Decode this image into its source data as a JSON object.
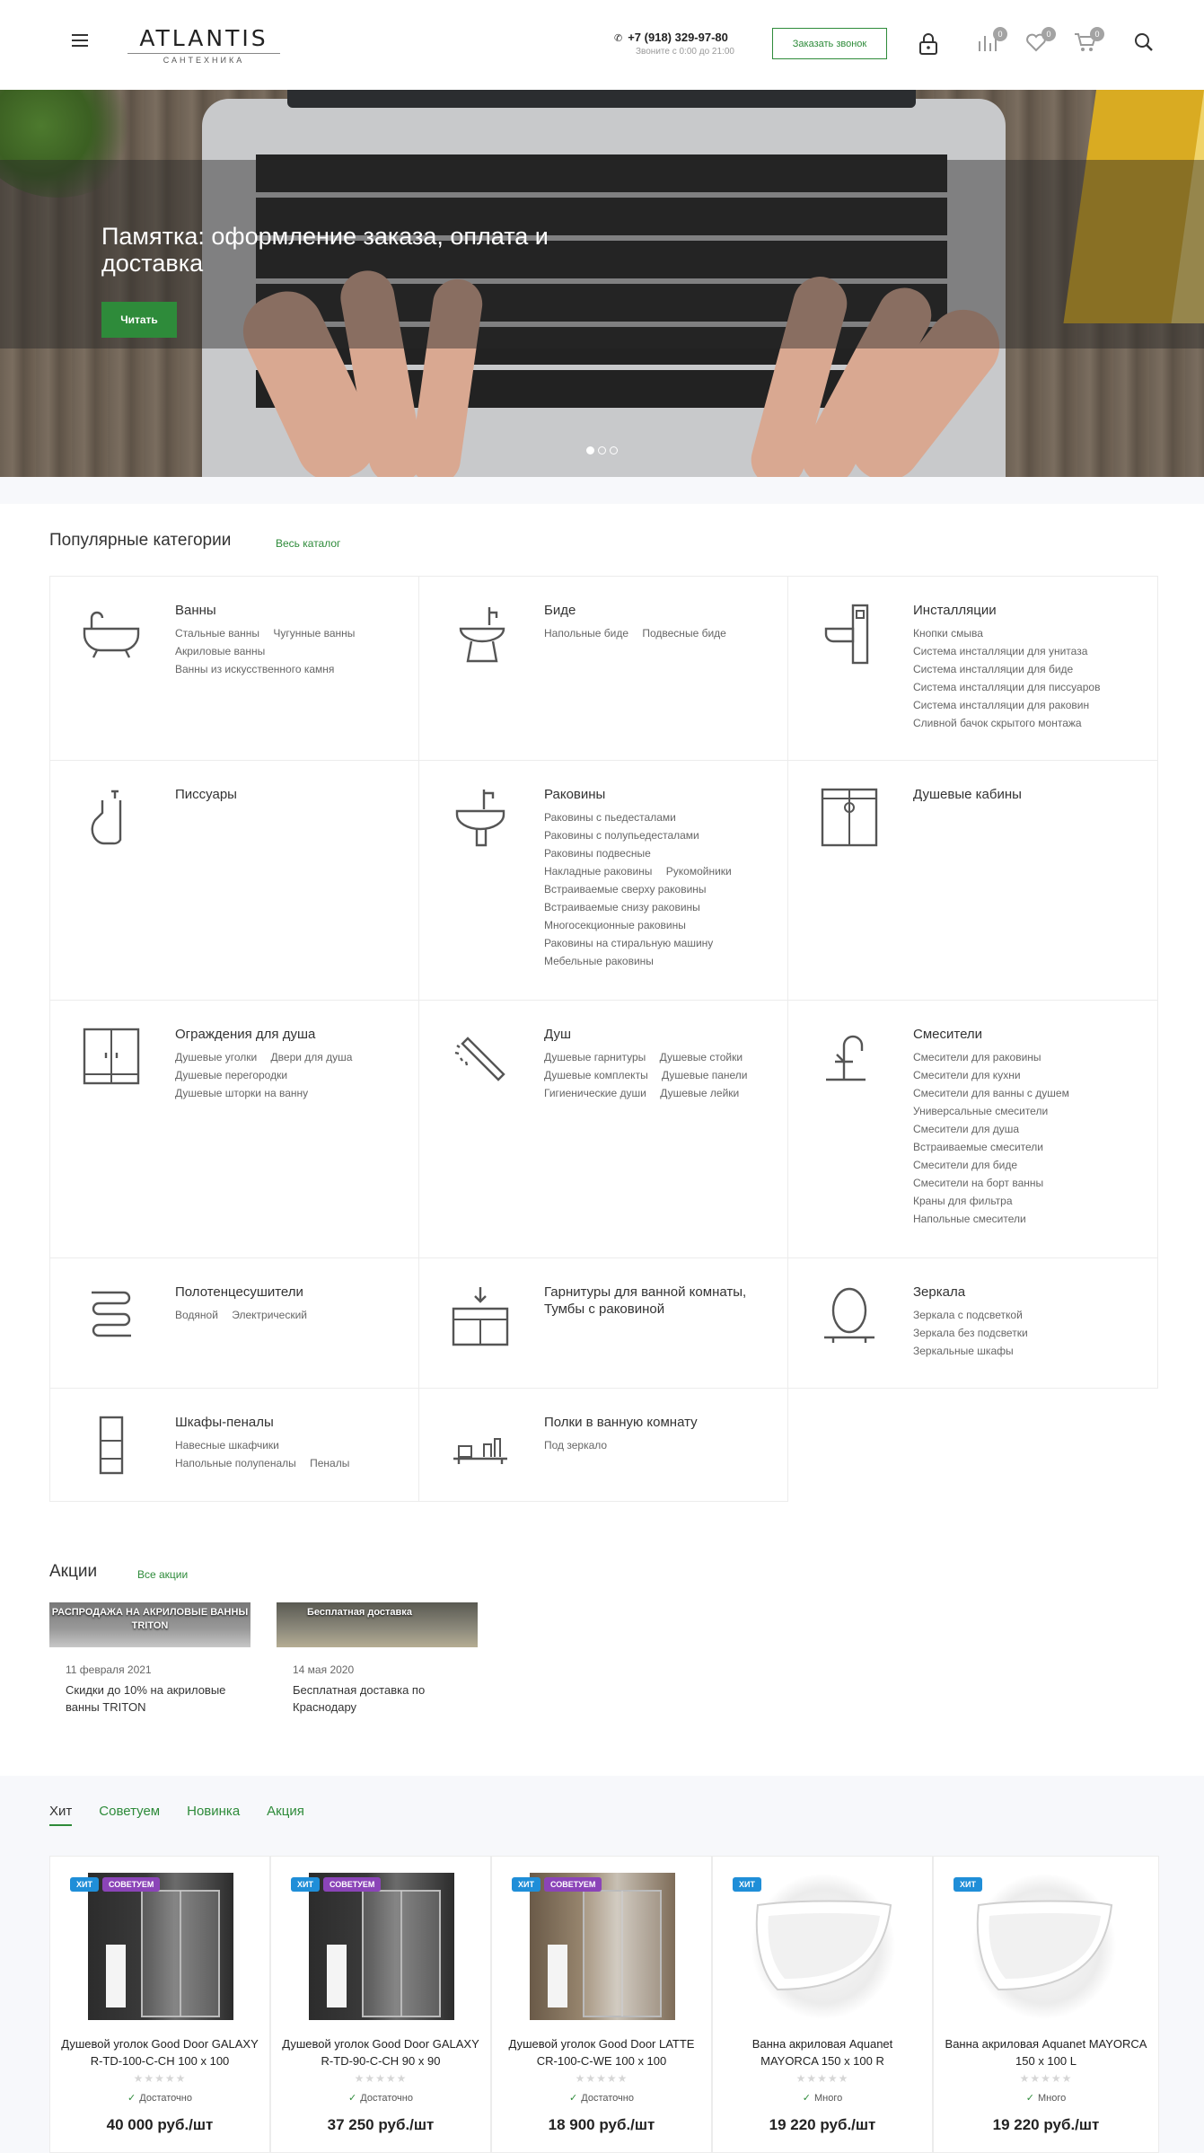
{
  "header": {
    "logo_main": "ATLANTIS",
    "logo_sub": "САНТЕХНИКА",
    "phone": "+7 (918) 329-97-80",
    "phone_hint": "Звоните с 0:00 до 21:00",
    "callback_label": "Заказать звонок",
    "compare_count": "0",
    "favorites_count": "0",
    "cart_count": "0"
  },
  "hero": {
    "title": "Памятка: оформление заказа, оплата и доставка",
    "button_label": "Читать"
  },
  "categories": {
    "title": "Популярные категории",
    "link": "Весь каталог",
    "items": [
      {
        "title": "Ванны",
        "subs": [
          "Стальные ванны",
          "Чугунные ванны",
          "Акриловые ванны",
          "Ванны из искусственного камня"
        ]
      },
      {
        "title": "Биде",
        "subs": [
          "Напольные биде",
          "Подвесные биде"
        ]
      },
      {
        "title": "Инсталляции",
        "subs": [
          "Кнопки смыва",
          "Система инсталляции для унитаза",
          "Система инсталляции для биде",
          "Система инсталляции для писсуаров",
          "Система инсталляции для раковин",
          "Сливной бачок скрытого монтажа"
        ]
      },
      {
        "title": "Писсуары",
        "subs": []
      },
      {
        "title": "Раковины",
        "subs": [
          "Раковины с пьедесталами",
          "Раковины с полупьедесталами",
          "Раковины подвесные",
          "Накладные раковины",
          "Рукомойники",
          "Встраиваемые сверху раковины",
          "Встраиваемые снизу раковины",
          "Многосекционные раковины",
          "Раковины на стиральную машину",
          "Мебельные раковины"
        ]
      },
      {
        "title": "Душевые кабины",
        "subs": []
      },
      {
        "title": "Ограждения для душа",
        "subs": [
          "Душевые уголки",
          "Двери для душа",
          "Душевые перегородки",
          "Душевые шторки на ванну"
        ]
      },
      {
        "title": "Душ",
        "subs": [
          "Душевые гарнитуры",
          "Душевые стойки",
          "Душевые комплекты",
          "Душевые панели",
          "Гигиенические души",
          "Душевые лейки"
        ]
      },
      {
        "title": "Смесители",
        "subs": [
          "Смесители для раковины",
          "Смесители для кухни",
          "Смесители для ванны с душем",
          "Универсальные смесители",
          "Смесители для душа",
          "Встраиваемые смесители",
          "Смесители для биде",
          "Смесители на борт ванны",
          "Краны для фильтра",
          "Напольные смесители"
        ]
      },
      {
        "title": "Полотенцесушители",
        "subs": [
          "Водяной",
          "Электрический"
        ]
      },
      {
        "title": "Гарнитуры для ванной комнаты, Тумбы с раковиной",
        "subs": []
      },
      {
        "title": "Зеркала",
        "subs": [
          "Зеркала с подсветкой",
          "Зеркала без подсветки",
          "Зеркальные шкафы"
        ]
      },
      {
        "title": "Шкафы-пеналы",
        "subs": [
          "Навесные шкафчики",
          "Напольные полупеналы",
          "Пеналы"
        ]
      },
      {
        "title": "Полки в ванную комнату",
        "subs": [
          "Под зеркало"
        ]
      }
    ]
  },
  "promos": {
    "title": "Акции",
    "link": "Все акции",
    "items": [
      {
        "banner": "РАСПРОДАЖА НА АКРИЛОВЫЕ ВАННЫ TRITON",
        "date": "11 февраля 2021",
        "text": "Скидки до 10% на акриловые ванны TRITON"
      },
      {
        "banner": "Бесплатная доставка",
        "date": "14 мая 2020",
        "text": "Бесплатная доставка по Краснодару"
      }
    ]
  },
  "tabs": [
    "Хит",
    "Советуем",
    "Новинка",
    "Акция"
  ],
  "labels": {
    "hit": "ХИТ",
    "rec": "СОВЕТУЕМ"
  },
  "stars": "★★★★★",
  "products": [
    {
      "name": "Душевой уголок Good Door GALAXY R-TD-100-C-CH 100 x 100",
      "stock": "Достаточно",
      "price": "40 000 руб./шт",
      "rec": true
    },
    {
      "name": "Душевой уголок Good Door GALAXY R-TD-90-C-CH 90 x 90",
      "stock": "Достаточно",
      "price": "37 250 руб./шт",
      "rec": true
    },
    {
      "name": "Душевой уголок Good Door LATTE CR-100-C-WE 100 x 100",
      "stock": "Достаточно",
      "price": "18 900 руб./шт",
      "rec": true
    },
    {
      "name": "Ванна акриловая Aquanet MAYORCA 150 x 100 R",
      "stock": "Много",
      "price": "19 220 руб./шт",
      "rec": false
    },
    {
      "name": "Ванна акриловая Aquanet MAYORCA 150 x 100 L",
      "stock": "Много",
      "price": "19 220 руб./шт",
      "rec": false
    }
  ],
  "colors": {
    "accent": "#2e8b3a",
    "hit": "#1f8ed8",
    "rec": "#8b44b8"
  }
}
